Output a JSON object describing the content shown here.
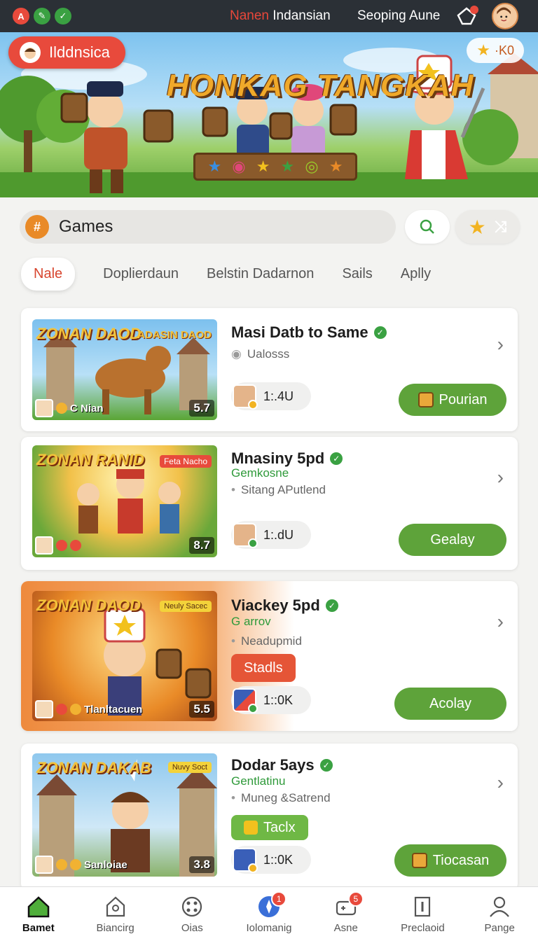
{
  "topbar": {
    "title_red": "Nanen",
    "title_white": "Indansian",
    "right_title": "Seoping Aune"
  },
  "banner": {
    "tag": "Ilddnsica",
    "title": "HONKAG TANGKAH",
    "pill_value": "·K0"
  },
  "search": {
    "value": "Games"
  },
  "tabs": [
    "Nale",
    "Doplierdaun",
    "Belstin Dadarnon",
    "Sails",
    "Aplly"
  ],
  "cards": [
    {
      "logo": "ZONAN DAOD",
      "thumb_tag": "ADASIN DAOD",
      "thumb_text": "C Nian",
      "rating": "5.7",
      "title": "Masi Datb to Same",
      "subtitle": "",
      "meta": "Ualosss",
      "count": "1:.4U",
      "button": "Pourian"
    },
    {
      "logo": "ZONAN RANID",
      "thumb_tag": "Feta Nacho",
      "thumb_text": "",
      "rating": "8.7",
      "title": "Mnasiny 5pd",
      "subtitle": "Gemkosne",
      "meta": "Sitang APutlend",
      "count": "1:.dU",
      "button": "Gealay"
    },
    {
      "logo": "ZONAN DAOD",
      "thumb_tag": "Neuly Sacec",
      "thumb_text": "Tlanltacuen",
      "rating": "5.5",
      "title": "Viackey 5pd",
      "subtitle": "G arrov",
      "meta": "Neadupmid",
      "tag": "Stadls",
      "count": "1::0K",
      "button": "Acolay"
    },
    {
      "logo": "ZONAN DAKAB",
      "thumb_tag": "Nuvy Soct",
      "thumb_text": "Sanloiae",
      "rating": "3.8",
      "title": "Dodar 5ays",
      "subtitle": "Gentlatinu",
      "meta": "Muneg &Satrend",
      "tag": "Taclx",
      "count": "1::0K",
      "button": "Tiocasan"
    }
  ],
  "bottomnav": [
    {
      "label": "Bamet",
      "badge": ""
    },
    {
      "label": "Biancirg",
      "badge": ""
    },
    {
      "label": "Oias",
      "badge": ""
    },
    {
      "label": "Iolomanig",
      "badge": "1"
    },
    {
      "label": "Asne",
      "badge": "5"
    },
    {
      "label": "Preclaoid",
      "badge": ""
    },
    {
      "label": "Pange",
      "badge": ""
    }
  ],
  "colors": {
    "accent_red": "#e84a3c",
    "accent_green": "#5ea33a",
    "accent_orange": "#ee8a3d",
    "topbar": "#2b3036"
  }
}
